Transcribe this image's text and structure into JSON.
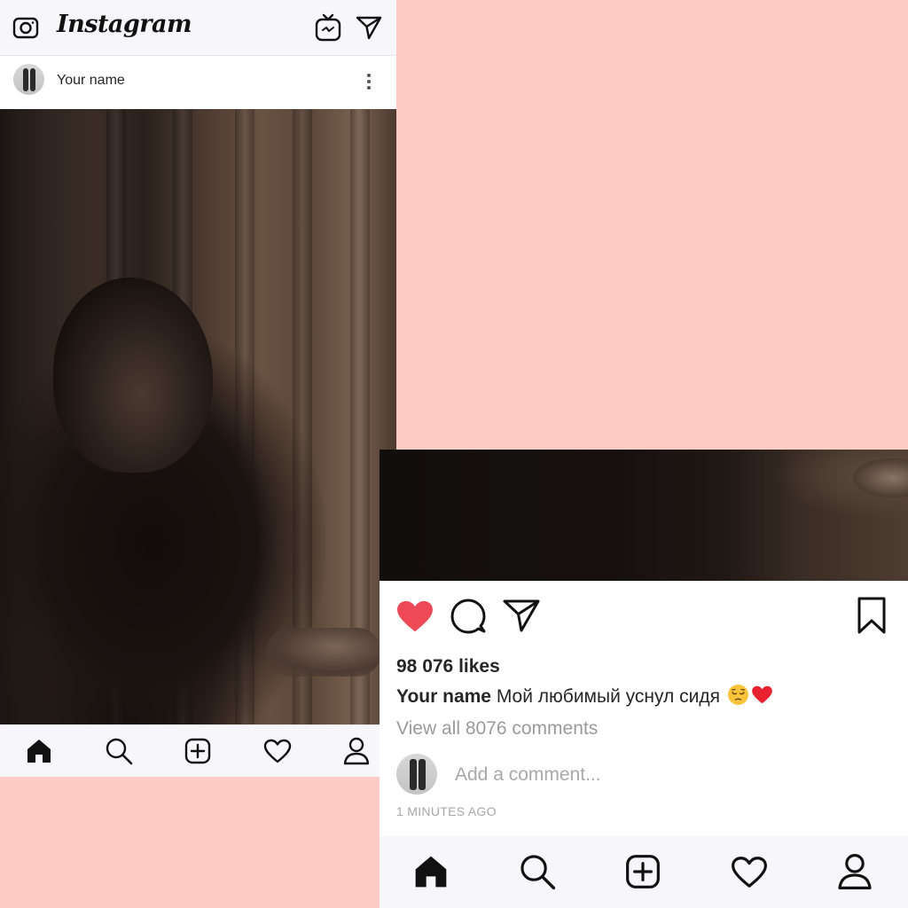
{
  "app": {
    "logo": "Instagram"
  },
  "post": {
    "username": "Your name",
    "likes": "98 076 likes",
    "caption_user": "Your name",
    "caption_text": "Мой любимый уснул сидя ",
    "view_comments": "View all 8076 comments",
    "add_comment_placeholder": "Add a comment...",
    "time_ago": "1 MINUTES AGO"
  },
  "colors": {
    "background": "#ffcbc5",
    "heart": "#ed4956",
    "bar": "#f7f6fa"
  },
  "icons": {
    "topbar": [
      "camera-icon",
      "igtv-icon",
      "send-icon"
    ],
    "actions": [
      "heart-icon",
      "comment-icon",
      "share-icon",
      "bookmark-icon"
    ],
    "nav": [
      "home-icon",
      "search-icon",
      "add-post-icon",
      "activity-icon",
      "profile-icon"
    ],
    "caption_emojis": [
      "pensive-face-emoji",
      "red-heart-emoji"
    ]
  }
}
